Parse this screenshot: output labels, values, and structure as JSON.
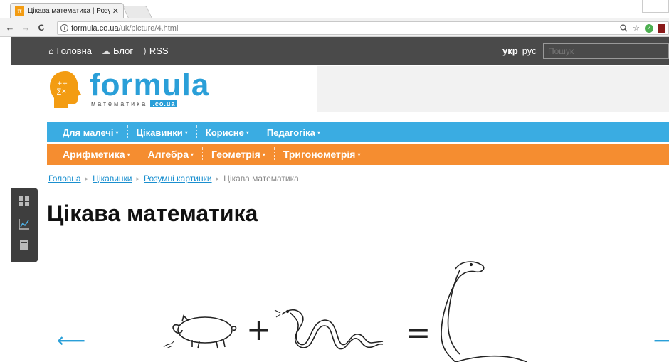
{
  "browser": {
    "tab_title": "Цікава математика | Розумні картинки",
    "tab_favicon": "π",
    "tab_close": "✕",
    "url_host": "formula.co.ua",
    "url_path": "/uk/picture/4.html",
    "back": "←",
    "forward": "→",
    "reload": "C",
    "zoom_icon": "zoom-icon",
    "star": "☆"
  },
  "topbar": {
    "home": "Головна",
    "blog": "Блог",
    "rss": "RSS",
    "lang_active": "укр",
    "lang_other": "рус",
    "search_placeholder": "Пошук"
  },
  "logo": {
    "word": "formula",
    "sub": "математика",
    "domain": ".co.ua"
  },
  "menu_blue": [
    {
      "label": "Для малечі"
    },
    {
      "label": "Цікавинки"
    },
    {
      "label": "Корисне"
    },
    {
      "label": "Педагогіка"
    }
  ],
  "menu_orange": [
    {
      "label": "Арифметика"
    },
    {
      "label": "Алгебра"
    },
    {
      "label": "Геометрія"
    },
    {
      "label": "Тригонометрія"
    }
  ],
  "caret": "▾",
  "breadcrumb": {
    "items": [
      "Головна",
      "Цікавинки",
      "Розумні картинки"
    ],
    "current": "Цікава математика",
    "sep": "▸"
  },
  "page": {
    "title": "Цікава математика",
    "prev_arrow": "⟵",
    "next_arrow": "⟶",
    "plus": "+",
    "equals": "="
  },
  "colors": {
    "blue": "#3aace2",
    "orange": "#f58d30",
    "topbar": "#4a4a4a"
  }
}
